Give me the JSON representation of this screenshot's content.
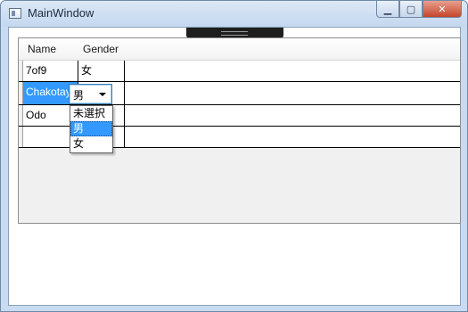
{
  "window": {
    "title": "MainWindow"
  },
  "caption_buttons": {
    "minimize": "▁",
    "maximize": "▢",
    "close": "✕"
  },
  "grid": {
    "columns": [
      "Name",
      "Gender"
    ],
    "rows": [
      {
        "name": "7of9",
        "gender": "女"
      },
      {
        "name": "Chakotay",
        "gender": "男"
      },
      {
        "name": "Odo",
        "gender": ""
      },
      {
        "name": "",
        "gender": ""
      }
    ]
  },
  "gender_combo": {
    "selected": "男"
  },
  "gender_options": [
    "未選択",
    "男",
    "女"
  ],
  "colors": {
    "selection": "#3399ff",
    "grid_background": "#f0f0f0"
  }
}
